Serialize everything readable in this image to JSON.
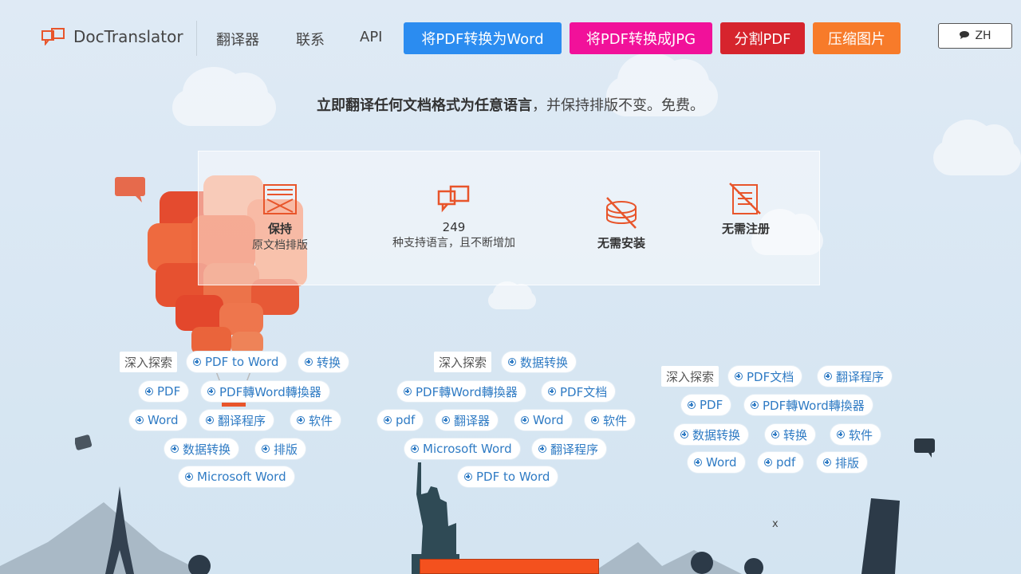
{
  "header": {
    "logo_text": "DocTranslator",
    "nav": [
      "翻译器",
      "联系",
      "API"
    ],
    "buttons": [
      {
        "label": "将PDF转换为Word",
        "color": "#2b8cf0"
      },
      {
        "label": "将PDF转换成JPG",
        "color": "#f1119a"
      },
      {
        "label": "分割PDF",
        "color": "#d6242d"
      },
      {
        "label": "压缩图片",
        "color": "#f77b2a"
      }
    ],
    "lang": "ZH"
  },
  "tagline": {
    "bold": "立即翻译任何文档格式为任意语言",
    "rest": "，并保持排版不变。免费。"
  },
  "features": [
    {
      "title": "保持",
      "subtitle": "原文档排版",
      "icon": "layout-icon"
    },
    {
      "title": "249",
      "subtitle": "种支持语言，且不断增加",
      "icon": "translate-icon"
    },
    {
      "title": "无需安装",
      "subtitle": "",
      "icon": "no-install-icon"
    },
    {
      "title": "无需注册",
      "subtitle": "",
      "icon": "no-register-icon"
    }
  ],
  "tag_clouds": [
    {
      "title": "深入探索",
      "tags": [
        "PDF to Word",
        "转换",
        "PDF",
        "PDF轉Word轉換器",
        "Word",
        "翻译程序",
        "软件",
        "数据转换",
        "排版",
        "Microsoft Word"
      ]
    },
    {
      "title": "深入探索",
      "tags": [
        "数据转换",
        "PDF轉Word轉換器",
        "PDF文档",
        "pdf",
        "翻译器",
        "Word",
        "软件",
        "Microsoft Word",
        "翻译程序",
        "PDF to Word"
      ]
    },
    {
      "title": "深入探索",
      "tags": [
        "PDF文档",
        "翻译程序",
        "PDF",
        "PDF轉Word轉換器",
        "数据转换",
        "转换",
        "软件",
        "Word",
        "pdf",
        "排版"
      ]
    }
  ],
  "close_label": "x",
  "colors": {
    "accent_orange": "#e8552b",
    "tag_blue": "#2f7bc4"
  }
}
